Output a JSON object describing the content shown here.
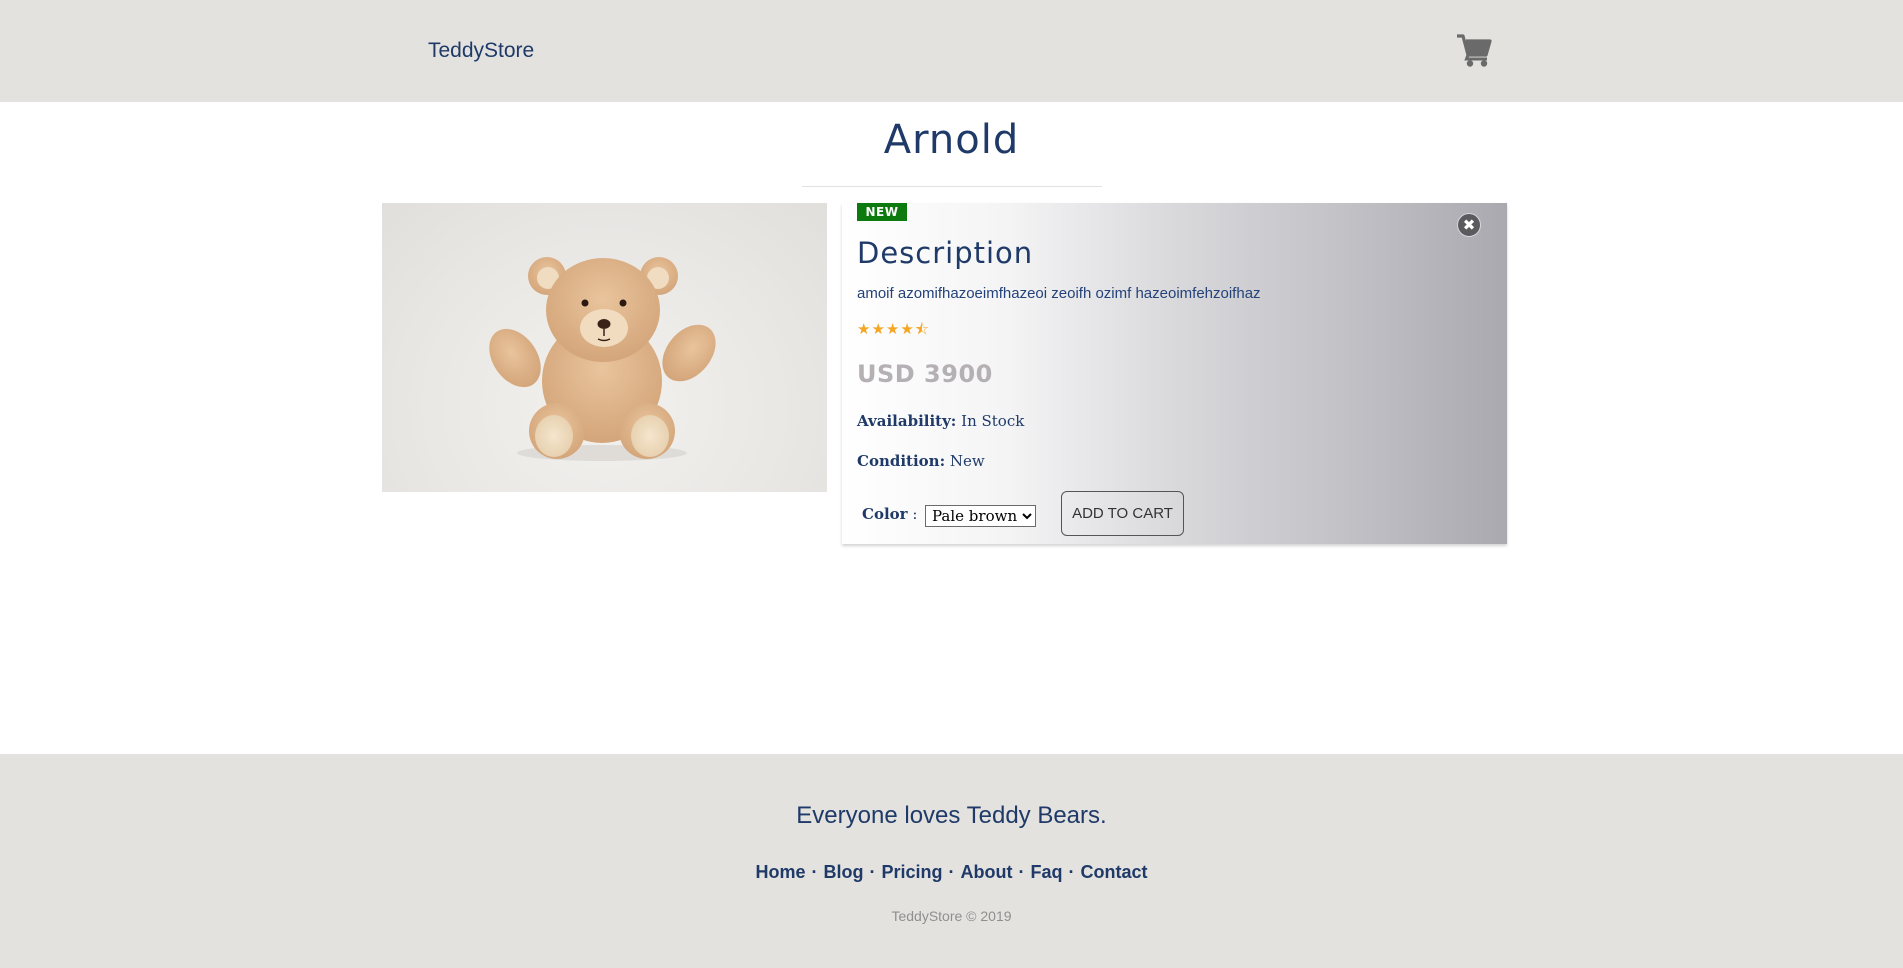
{
  "header": {
    "brand": "TeddyStore",
    "cart_icon": "shopping-cart-icon"
  },
  "product": {
    "name": "Arnold",
    "image_alt": "teddy bear",
    "badge": "NEW",
    "close_icon": "close-circle-icon",
    "description_heading": "Description",
    "description_text": "amoif azomifhazoeimfhazeoi zeoifh ozimf hazeoimfehzoifhaz",
    "rating": 4.5,
    "rating_max": 5,
    "stars": "★★★★⯪",
    "price": "USD 3900",
    "availability_label": "Availability:",
    "availability_value": "In Stock",
    "condition_label": "Condition:",
    "condition_value": "New",
    "color_label": "Color",
    "color_sep": ":",
    "color_selected": "Pale brown",
    "add_to_cart": "ADD TO CART"
  },
  "footer": {
    "tagline": "Everyone loves Teddy Bears.",
    "links": [
      "Home",
      "Blog",
      "Pricing",
      "About",
      "Faq",
      "Contact"
    ],
    "separator": "·",
    "copyright": "TeddyStore © 2019"
  },
  "colors": {
    "primary": "#1f3a68",
    "header_bg": "#e3e2df",
    "badge_bg": "#0d7a10",
    "star": "#f5a623",
    "price": "#b4b0b4"
  }
}
